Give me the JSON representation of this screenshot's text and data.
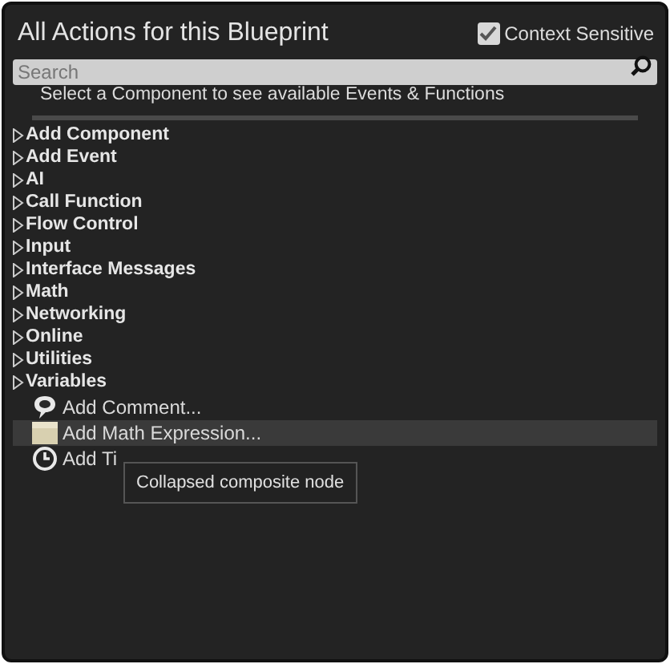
{
  "window": {
    "title": "All Actions for this Blueprint"
  },
  "context_sensitive": {
    "label": "Context Sensitive",
    "checked": true
  },
  "search": {
    "placeholder": "Search"
  },
  "hint": "Select a Component to see available Events & Functions",
  "categories": [
    {
      "label": "Add Component",
      "expanded": false
    },
    {
      "label": "Add Event",
      "expanded": false
    },
    {
      "label": "AI",
      "expanded": false
    },
    {
      "label": "Call Function",
      "expanded": false
    },
    {
      "label": "Flow Control",
      "expanded": false
    },
    {
      "label": "Input",
      "expanded": false
    },
    {
      "label": "Interface Messages",
      "expanded": false
    },
    {
      "label": "Math",
      "expanded": false
    },
    {
      "label": "Networking",
      "expanded": false
    },
    {
      "label": "Online",
      "expanded": false
    },
    {
      "label": "Utilities",
      "expanded": false
    },
    {
      "label": "Variables",
      "expanded": false
    }
  ],
  "actions": [
    {
      "kind": "comment",
      "label": "Add Comment...",
      "hovered": false
    },
    {
      "kind": "math",
      "label": "Add Math Expression...",
      "hovered": true
    },
    {
      "kind": "timeline",
      "label": "Add Ti",
      "hovered": false
    }
  ],
  "tooltip": "Collapsed composite node"
}
